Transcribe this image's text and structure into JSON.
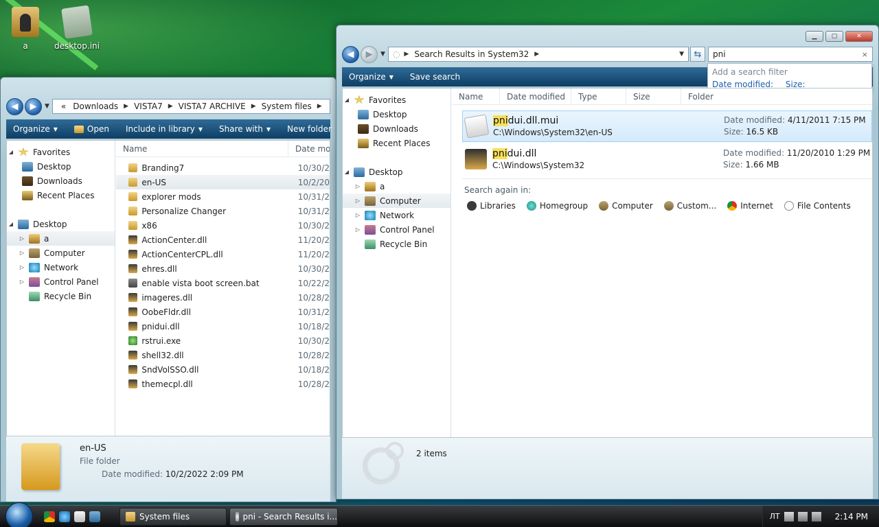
{
  "desktop": {
    "icons": [
      {
        "label": "a"
      },
      {
        "label": "desktop.ini"
      }
    ]
  },
  "left_window": {
    "breadcrumb": {
      "overflow": "«",
      "parts": [
        "Downloads",
        "VISTA7",
        "VISTA7 ARCHIVE",
        "System files"
      ]
    },
    "toolbar": {
      "organize": "Organize",
      "open": "Open",
      "include": "Include in library",
      "share": "Share with",
      "new_folder": "New folder"
    },
    "nav": {
      "favorites": "Favorites",
      "desktop": "Desktop",
      "downloads": "Downloads",
      "recent": "Recent Places",
      "desktop_root": "Desktop",
      "user": "a",
      "computer": "Computer",
      "network": "Network",
      "control_panel": "Control Panel",
      "recycle": "Recycle Bin"
    },
    "columns": {
      "name": "Name",
      "date": "Date mo"
    },
    "files": [
      {
        "name": "Branding7",
        "date": "10/30/2"
      },
      {
        "name": "en-US",
        "date": "10/2/20"
      },
      {
        "name": "explorer mods",
        "date": "10/31/2"
      },
      {
        "name": "Personalize Changer",
        "date": "10/31/2"
      },
      {
        "name": "x86",
        "date": "10/30/2"
      },
      {
        "name": "ActionCenter.dll",
        "date": "11/20/2"
      },
      {
        "name": "ActionCenterCPL.dll",
        "date": "11/20/2"
      },
      {
        "name": "ehres.dll",
        "date": "10/30/2"
      },
      {
        "name": "enable vista boot screen.bat",
        "date": "10/22/2"
      },
      {
        "name": "imageres.dll",
        "date": "10/28/2"
      },
      {
        "name": "OobeFldr.dll",
        "date": "10/31/2"
      },
      {
        "name": "pnidui.dll",
        "date": "10/18/2"
      },
      {
        "name": "rstrui.exe",
        "date": "10/30/2"
      },
      {
        "name": "shell32.dll",
        "date": "10/28/2"
      },
      {
        "name": "SndVolSSO.dll",
        "date": "10/18/2"
      },
      {
        "name": "themecpl.dll",
        "date": "10/28/2"
      }
    ],
    "details": {
      "name": "en-US",
      "type": "File folder",
      "date_label": "Date modified:",
      "date_value": "10/2/2022 2:09 PM"
    }
  },
  "right_window": {
    "breadcrumb": {
      "text": "Search Results in System32"
    },
    "search": {
      "value": "pni",
      "clear": "×"
    },
    "filter_popup": {
      "title": "Add a search filter",
      "date_link": "Date modified:",
      "size_link": "Size:"
    },
    "toolbar": {
      "organize": "Organize",
      "save": "Save search"
    },
    "nav": {
      "favorites": "Favorites",
      "desktop": "Desktop",
      "downloads": "Downloads",
      "recent": "Recent Places",
      "desktop_root": "Desktop",
      "user": "a",
      "computer": "Computer",
      "network": "Network",
      "control_panel": "Control Panel",
      "recycle": "Recycle Bin"
    },
    "columns": {
      "name": "Name",
      "date": "Date modified",
      "type": "Type",
      "size": "Size",
      "folder": "Folder"
    },
    "results": [
      {
        "highlight": "pni",
        "rest": "dui.dll.mui",
        "path": "C:\\Windows\\System32\\en-US",
        "date_label": "Date modified:",
        "date": "4/11/2011 7:15 PM",
        "size_label": "Size:",
        "size": "16.5 KB"
      },
      {
        "highlight": "pni",
        "rest": "dui.dll",
        "path": "C:\\Windows\\System32",
        "date_label": "Date modified:",
        "date": "11/20/2010 1:29 PM",
        "size_label": "Size:",
        "size": "1.66 MB"
      }
    ],
    "search_again": {
      "label": "Search again in:",
      "items": [
        "Libraries",
        "Homegroup",
        "Computer",
        "Custom...",
        "Internet",
        "File Contents"
      ]
    },
    "status": {
      "count": "2 items"
    }
  },
  "taskbar": {
    "tasks": [
      {
        "label": "System files"
      },
      {
        "label": "pni - Search Results i..."
      }
    ],
    "lang": "ЛТ",
    "clock": "2:14 PM"
  }
}
